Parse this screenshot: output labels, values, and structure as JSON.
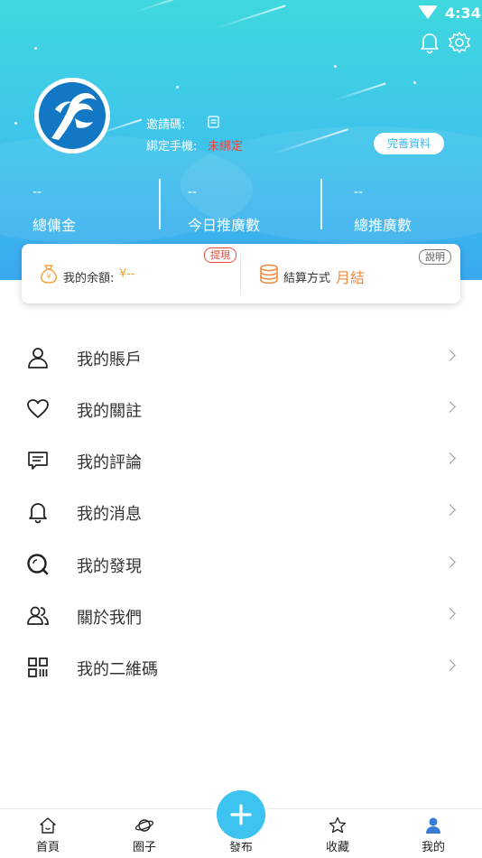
{
  "status_bar": {
    "time": "4:34"
  },
  "profile": {
    "invite_code_label": "邀請碼:",
    "phone_label": "綁定手機:",
    "phone_value": "未綁定",
    "complete_button": "完善資料"
  },
  "stats": [
    {
      "value": "--",
      "label": "總傭金"
    },
    {
      "value": "--",
      "label": "今日推廣數"
    },
    {
      "value": "--",
      "label": "總推廣數"
    }
  ],
  "balance_card": {
    "balance_label": "我的余額:",
    "balance_value": "¥--",
    "withdraw_tag": "提現",
    "settlement_label": "結算方式",
    "settlement_value": "月結",
    "explain_tag": "說明"
  },
  "menu": [
    {
      "label": "我的賬戶",
      "icon": "user-icon"
    },
    {
      "label": "我的關註",
      "icon": "heart-icon"
    },
    {
      "label": "我的評論",
      "icon": "comment-icon"
    },
    {
      "label": "我的消息",
      "icon": "bell-icon"
    },
    {
      "label": "我的發現",
      "icon": "discover-icon"
    },
    {
      "label": "關於我們",
      "icon": "group-icon"
    },
    {
      "label": "我的二維碼",
      "icon": "qrcode-icon"
    }
  ],
  "tabbar": {
    "home": "首頁",
    "circle": "圈子",
    "publish": "發布",
    "favorites": "收藏",
    "mine": "我的"
  },
  "colors": {
    "accent": "#3cc3f0",
    "warning_red": "#e8453c",
    "orange": "#f08a3c",
    "active_tab_icon": "#3a7bd5"
  }
}
